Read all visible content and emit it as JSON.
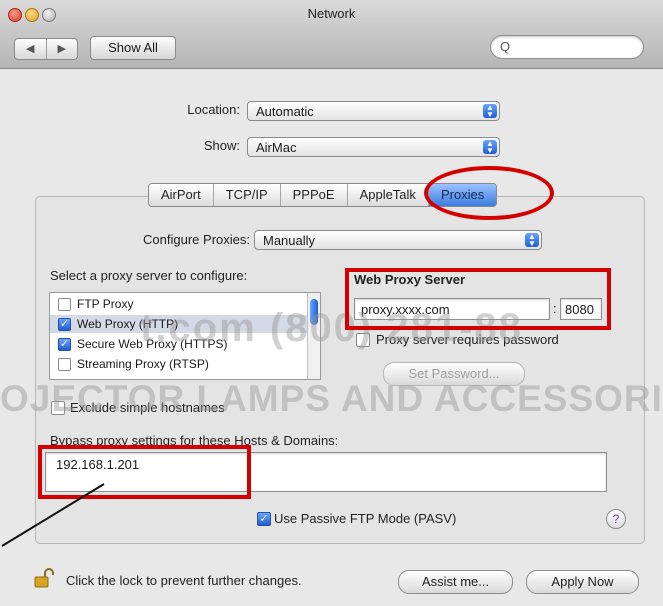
{
  "window": {
    "title": "Network"
  },
  "toolbar": {
    "back": "◀",
    "forward": "▶",
    "show_all": "Show All",
    "search_icon": "magnifier-icon",
    "search_glyph": "Q"
  },
  "location": {
    "label": "Location:",
    "value": "Automatic"
  },
  "show": {
    "label": "Show:",
    "value": "AirMac"
  },
  "tabs": [
    "AirPort",
    "TCP/IP",
    "PPPoE",
    "AppleTalk",
    "Proxies"
  ],
  "active_tab": "Proxies",
  "configure": {
    "label": "Configure Proxies:",
    "value": "Manually"
  },
  "proxy_list": {
    "label": "Select a proxy server to configure:",
    "items": [
      {
        "label": "FTP Proxy",
        "checked": false
      },
      {
        "label": "Web Proxy (HTTP)",
        "checked": true
      },
      {
        "label": "Secure Web Proxy (HTTPS)",
        "checked": true
      },
      {
        "label": "Streaming Proxy (RTSP)",
        "checked": false
      }
    ]
  },
  "web_proxy": {
    "label": "Web Proxy Server",
    "server": "proxy.xxxx.com",
    "separator": ":",
    "port": "8080",
    "requires_password_label": "Proxy server requires password",
    "requires_password": false,
    "set_password": "Set Password..."
  },
  "exclude_simple": {
    "label": "Exclude simple hostnames",
    "checked": false
  },
  "bypass": {
    "label": "Bypass proxy settings for these Hosts & Domains:",
    "value": "192.168.1.201"
  },
  "passive_ftp": {
    "label": "Use Passive FTP Mode (PASV)",
    "checked": true
  },
  "help_glyph": "?",
  "lock_text": "Click the lock to prevent further changes.",
  "assist": "Assist me...",
  "apply": "Apply Now",
  "watermark": {
    "line1": "t.com (800) 281-88",
    "line2": "OJECTOR LAMPS AND ACCESSORIES"
  },
  "colors": {
    "highlight": "#d40000",
    "accent": "#3b7be0"
  }
}
